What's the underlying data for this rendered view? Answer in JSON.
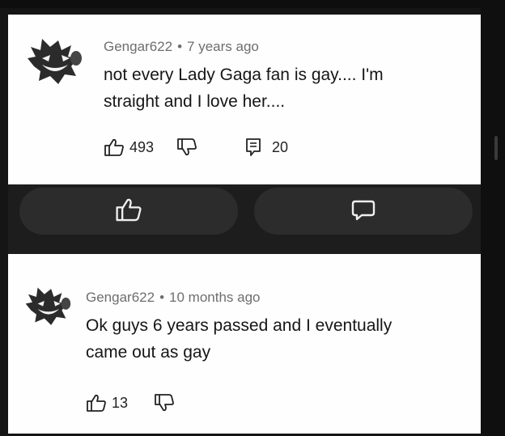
{
  "comments": [
    {
      "author": "Gengar622",
      "time": "7 years ago",
      "text_line1": "not every Lady Gaga fan is gay.... I'm",
      "text_line2": "straight and I love her....",
      "likes": "493",
      "replies": "20"
    },
    {
      "author": "Gengar622",
      "time": "10 months ago",
      "text_line1": "Ok guys 6 years passed and I eventually",
      "text_line2": "came out as gay",
      "likes": "13"
    }
  ],
  "separator": "•",
  "colors": {
    "background": "#151515",
    "card": "#fefefe",
    "band": "#1d1d1d",
    "pill": "#2c2c2c",
    "meta_text": "#6e6e6e"
  },
  "icons": [
    "gengar-avatar",
    "thumbs-up-icon",
    "thumbs-down-icon",
    "reply-icon",
    "comment-bubble-icon"
  ]
}
